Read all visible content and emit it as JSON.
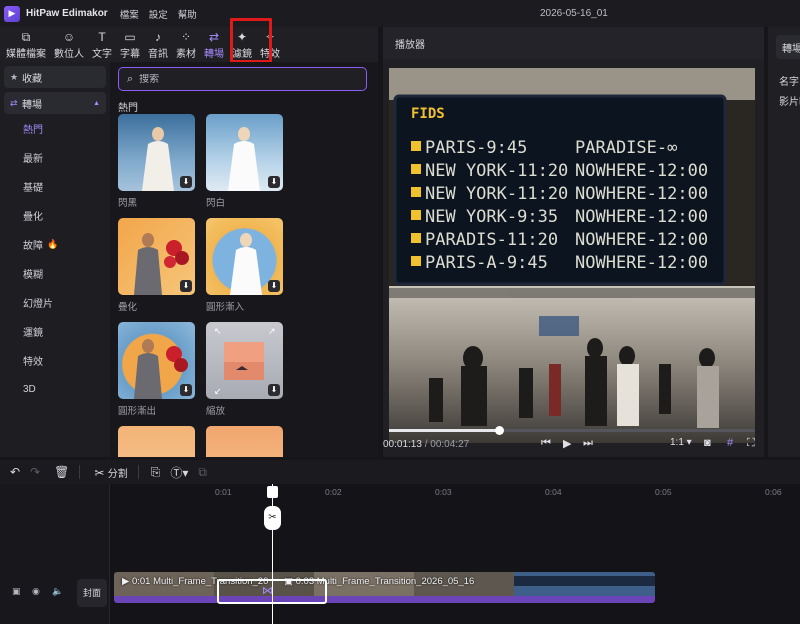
{
  "titlebar": {
    "app_name": "HitPaw Edimakor",
    "menus": [
      "檔案",
      "設定",
      "幫助"
    ],
    "document_title": "2026-05-16_01"
  },
  "toolbar": {
    "tools": [
      {
        "label": "媒體檔案",
        "icon": "media-icon"
      },
      {
        "label": "數位人",
        "icon": "avatar-icon"
      },
      {
        "label": "文字",
        "icon": "text-icon"
      },
      {
        "label": "字幕",
        "icon": "subtitle-icon"
      },
      {
        "label": "音訊",
        "icon": "music-icon"
      },
      {
        "label": "素材",
        "icon": "assets-icon"
      },
      {
        "label": "轉場",
        "icon": "transition-icon",
        "active": true
      },
      {
        "label": "濾鏡",
        "icon": "filter-icon"
      },
      {
        "label": "特效",
        "icon": "effects-icon"
      }
    ]
  },
  "sidebar": {
    "favorites": "收藏",
    "transitions": "轉場",
    "categories": [
      "熱門",
      "最新",
      "基礎",
      "疊化",
      "故障",
      "模糊",
      "幻燈片",
      "運鏡",
      "特效",
      "3D"
    ]
  },
  "browser": {
    "search_placeholder": "搜索",
    "section": "熱門",
    "items": [
      {
        "label": "閃黑"
      },
      {
        "label": "閃白"
      },
      {
        "label": "疊化"
      },
      {
        "label": "圓形漸入"
      },
      {
        "label": "圓形漸出"
      },
      {
        "label": "縮放"
      }
    ]
  },
  "player": {
    "title": "播放器",
    "current_time": "00:01:13",
    "separator": "/",
    "total_time": "00:04:27",
    "progress": 0.3,
    "ratio": "1:1",
    "board": {
      "header": "FIDS",
      "rows": [
        [
          "PARIS-9:45",
          "PARADISE-∞"
        ],
        [
          "NEW YORK-11:20",
          "NOWHERE-12:00"
        ],
        [
          "NEW YORK-11:20",
          "NOWHERE-12:00"
        ],
        [
          "NEW YORK-9:35",
          "NOWHERE-12:00"
        ],
        [
          "PARADIS-11:20",
          "NOWHERE-12:00"
        ],
        [
          "PARIS-A-9:45",
          "NOWHERE-12:00"
        ]
      ]
    }
  },
  "properties": {
    "tab": "轉場",
    "name_label": "名字：",
    "duration_label": "影片時"
  },
  "timeline_toolbar": {
    "split_label": "分割"
  },
  "timeline": {
    "ticks": [
      "0:01",
      "0:02",
      "0:03",
      "0:04",
      "0:05",
      "0:06"
    ],
    "cover_label": "封面",
    "clip1": "0:01 Multi_Frame_Transition_20",
    "clip2": "0:03 Multi_Frame_Transition_2026_05_16"
  },
  "colors": {
    "accent": "#a78bfa",
    "highlight": "#e01919",
    "clip_bar": "#6b44b8"
  }
}
